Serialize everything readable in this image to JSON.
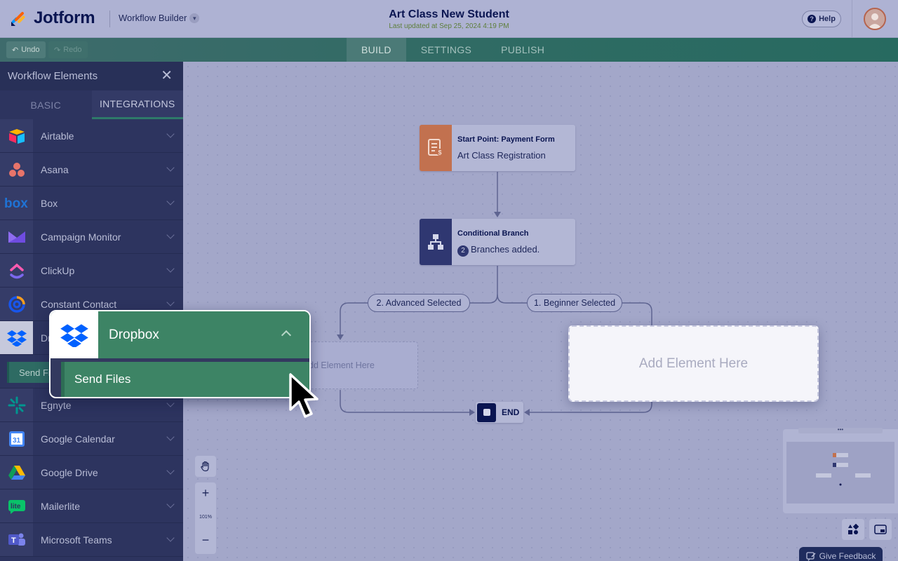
{
  "header": {
    "logo_text": "Jotform",
    "workspace": "Workflow Builder",
    "title": "Art Class New Student",
    "subtitle": "Last updated at Sep 25, 2024 4:19 PM",
    "help_label": "Help"
  },
  "toolbar": {
    "undo_label": "Undo",
    "redo_label": "Redo",
    "tabs": [
      {
        "label": "BUILD",
        "active": true
      },
      {
        "label": "SETTINGS",
        "active": false
      },
      {
        "label": "PUBLISH",
        "active": false
      }
    ]
  },
  "sidebar": {
    "title": "Workflow Elements",
    "tabs": [
      {
        "label": "BASIC",
        "active": false
      },
      {
        "label": "INTEGRATIONS",
        "active": true
      }
    ],
    "items": [
      {
        "label": "Airtable",
        "icon": "airtable-icon"
      },
      {
        "label": "Asana",
        "icon": "asana-icon"
      },
      {
        "label": "Box",
        "icon": "box-icon"
      },
      {
        "label": "Campaign Monitor",
        "icon": "campaign-monitor-icon"
      },
      {
        "label": "ClickUp",
        "icon": "clickup-icon"
      },
      {
        "label": "Constant Contact",
        "icon": "constant-contact-icon"
      },
      {
        "label": "Dropbox",
        "icon": "dropbox-icon"
      },
      {
        "label": "Egnyte",
        "icon": "egnyte-icon"
      },
      {
        "label": "Google Calendar",
        "icon": "google-calendar-icon"
      },
      {
        "label": "Google Drive",
        "icon": "google-drive-icon"
      },
      {
        "label": "Mailerlite",
        "icon": "mailerlite-icon"
      },
      {
        "label": "Microsoft Teams",
        "icon": "microsoft-teams-icon"
      }
    ],
    "send_files_label": "Send Files"
  },
  "canvas": {
    "start_node": {
      "title": "Start Point: Payment Form",
      "text": "Art Class Registration"
    },
    "branch_node": {
      "title": "Conditional Branch",
      "count": "2",
      "text": "Branches added."
    },
    "branch_left_label": "2. Advanced Selected",
    "branch_right_label": "1. Beginner Selected",
    "placeholder_left": "dd Element Here",
    "placeholder_right": "Add Element Here",
    "end_label": "END",
    "zoom_plus": "+",
    "zoom_level": "101%",
    "zoom_minus": "−",
    "minimap_handle": "•••",
    "feedback_label": "Give Feedback"
  },
  "popout": {
    "title": "Dropbox",
    "action": "Send Files"
  },
  "colors": {
    "brand_navy": "#0a1551",
    "accent_green": "#3d8465",
    "start_orange": "#c2714f",
    "branch_navy": "#2f3771"
  }
}
